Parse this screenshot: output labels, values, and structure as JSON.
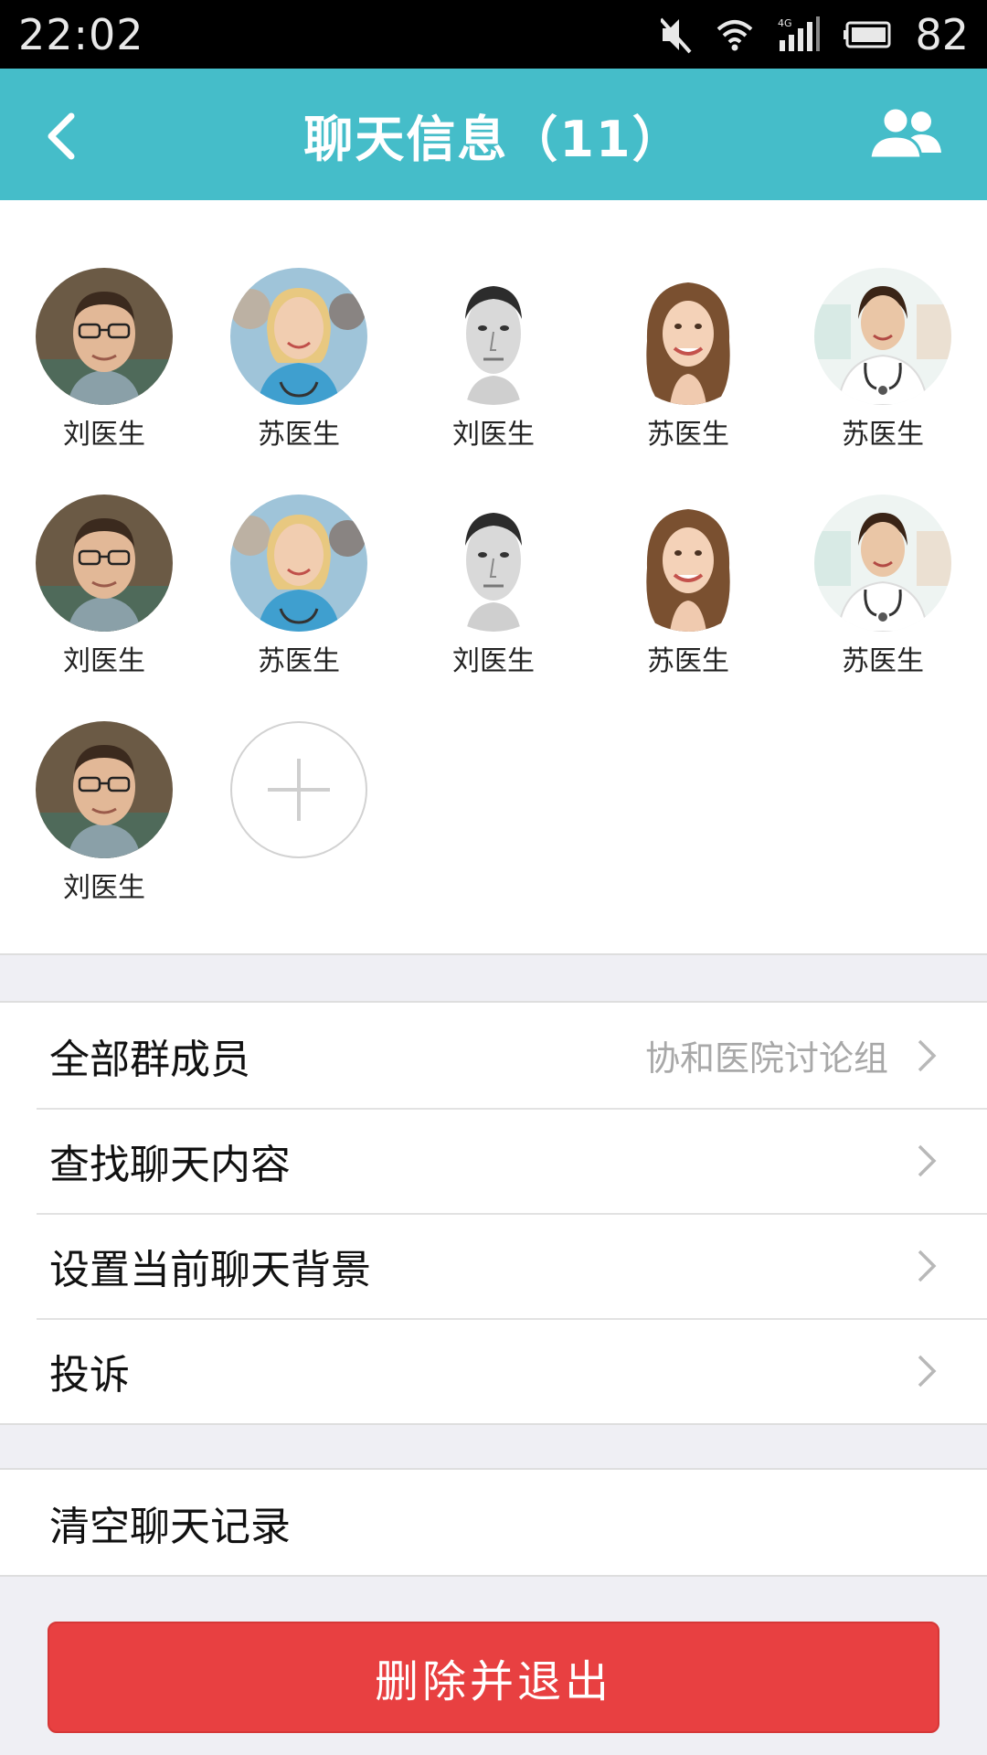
{
  "status_bar": {
    "time": "22:02",
    "battery": "82",
    "network": "4G"
  },
  "header": {
    "title": "聊天信息（11）"
  },
  "members": [
    {
      "name": "刘医生",
      "avatar": "man-glasses"
    },
    {
      "name": "苏医生",
      "avatar": "nurse-blonde"
    },
    {
      "name": "刘医生",
      "avatar": "man-bw"
    },
    {
      "name": "苏医生",
      "avatar": "woman-brunette"
    },
    {
      "name": "苏医生",
      "avatar": "doctor-woman"
    },
    {
      "name": "刘医生",
      "avatar": "man-glasses"
    },
    {
      "name": "苏医生",
      "avatar": "nurse-blonde"
    },
    {
      "name": "刘医生",
      "avatar": "man-bw"
    },
    {
      "name": "苏医生",
      "avatar": "woman-brunette"
    },
    {
      "name": "苏医生",
      "avatar": "doctor-woman"
    },
    {
      "name": "刘医生",
      "avatar": "man-glasses"
    }
  ],
  "settings": {
    "all_members": {
      "label": "全部群成员",
      "value": "协和医院讨论组"
    },
    "search_history": {
      "label": "查找聊天内容"
    },
    "set_background": {
      "label": "设置当前聊天背景"
    },
    "report": {
      "label": "投诉"
    },
    "clear_history": {
      "label": "清空聊天记录"
    }
  },
  "delete_exit": {
    "label": "删除并退出"
  },
  "colors": {
    "header": "#45bdc9",
    "danger": "#e84041",
    "background": "#efeff4"
  }
}
